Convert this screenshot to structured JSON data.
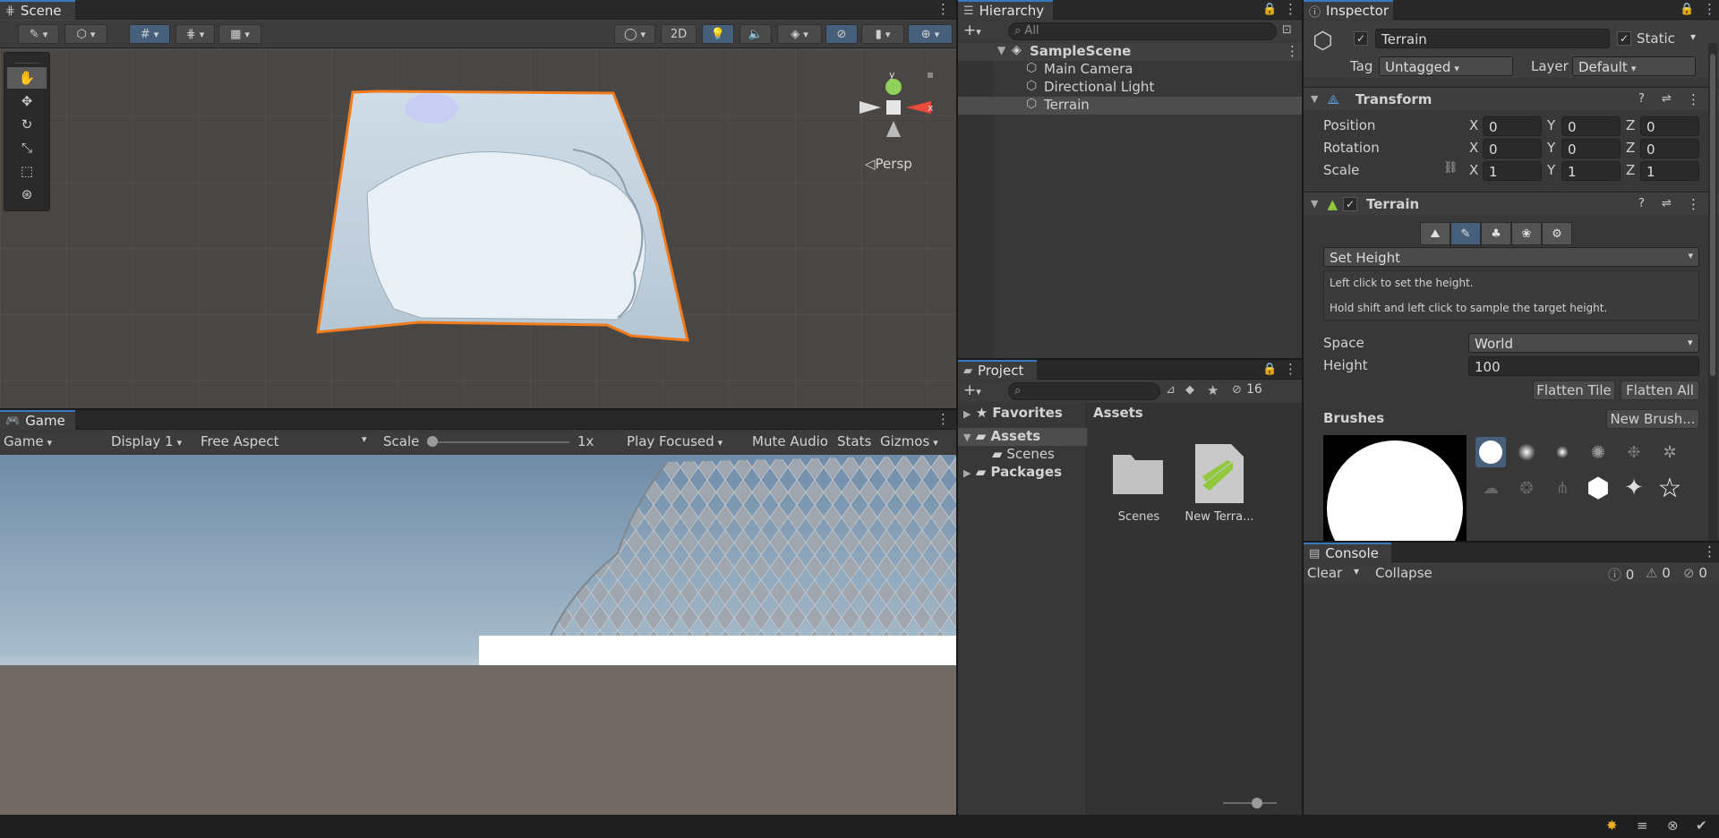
{
  "scene": {
    "tab_label": "Scene",
    "btn_2d": "2D",
    "persp_label": "◁Persp",
    "gizmo_y": "y",
    "gizmo_x": "x"
  },
  "game": {
    "tab_label": "Game",
    "view_select": "Game",
    "display_select": "Display 1",
    "aspect_select": "Free Aspect",
    "scale_label": "Scale",
    "scale_value": "1x",
    "scale_fraction": 0.0,
    "play_mode": "Play Focused",
    "mute_audio": "Mute Audio",
    "stats": "Stats",
    "gizmos": "Gizmos"
  },
  "hierarchy": {
    "tab_label": "Hierarchy",
    "search_placeholder": "All",
    "scene_name": "SampleScene",
    "items": [
      "Main Camera",
      "Directional Light",
      "Terrain"
    ],
    "selected": "Terrain"
  },
  "project": {
    "tab_label": "Project",
    "hidden_count": "16",
    "tree": {
      "favorites": "Favorites",
      "assets": "Assets",
      "scenes": "Scenes",
      "packages": "Packages"
    },
    "breadcrumb": "Assets",
    "assets": [
      "Scenes",
      "New Terra..."
    ]
  },
  "inspector": {
    "tab_label": "Inspector",
    "object_name": "Terrain",
    "static_label": "Static",
    "tag_label": "Tag",
    "tag_value": "Untagged",
    "layer_label": "Layer",
    "layer_value": "Default",
    "transform": {
      "title": "Transform",
      "position_label": "Position",
      "rotation_label": "Rotation",
      "scale_label": "Scale",
      "axis_x": "X",
      "axis_y": "Y",
      "axis_z": "Z",
      "position": [
        "0",
        "0",
        "0"
      ],
      "rotation": [
        "0",
        "0",
        "0"
      ],
      "scale": [
        "1",
        "1",
        "1"
      ]
    },
    "terrain": {
      "title": "Terrain",
      "tool": "Set Height",
      "help_line1": "Left click to set the height.",
      "help_line2": "Hold shift and left click to sample the target height.",
      "space_label": "Space",
      "space_value": "World",
      "height_label": "Height",
      "height_value": "100",
      "flatten_tile": "Flatten Tile",
      "flatten_all": "Flatten All",
      "brushes_label": "Brushes",
      "new_brush": "New Brush..."
    }
  },
  "console": {
    "tab_label": "Console",
    "clear": "Clear",
    "collapse": "Collapse",
    "info_count": "0",
    "warn_count": "0",
    "error_count": "0"
  },
  "colors": {
    "accent": "#3a79bb",
    "selection_orange": "#f07c1e",
    "panel": "#383838",
    "brand_green": "#92c83e"
  }
}
